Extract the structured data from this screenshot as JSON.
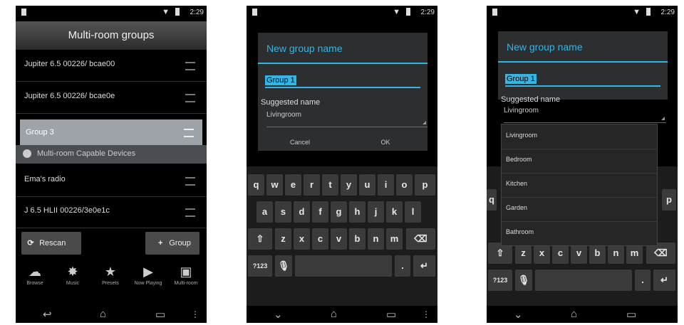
{
  "status": {
    "time": "2:29"
  },
  "screen1": {
    "title": "Multi-room groups",
    "groups": [
      "Jupiter 6.5 00226/ bcae00",
      "Jupiter 6.5 00226/ bcae0e"
    ],
    "dragged_item": "Group 3",
    "capable_header": "Multi-room Capable Devices",
    "devices": [
      "Ema's radio",
      "J 6.5 HLII 00226/3e0e1c"
    ],
    "rescan_label": "Rescan",
    "group_label": "Group",
    "tabs": [
      {
        "label": "Browse",
        "icon": "browse-icon"
      },
      {
        "label": "Music",
        "icon": "music-icon"
      },
      {
        "label": "Presets",
        "icon": "presets-icon"
      },
      {
        "label": "Now Playing",
        "icon": "now-playing-icon"
      },
      {
        "label": "Multi-room",
        "icon": "multi-room-icon"
      }
    ]
  },
  "dialog": {
    "title": "New group name",
    "input_value": "Group 1",
    "suggested_label": "Suggested name",
    "suggested_value": "Livingroom",
    "cancel_label": "Cancel",
    "ok_label": "OK"
  },
  "keyboard": {
    "row1": [
      "q",
      "w",
      "e",
      "r",
      "t",
      "y",
      "u",
      "i",
      "o",
      "p"
    ],
    "row2": [
      "a",
      "s",
      "d",
      "f",
      "g",
      "h",
      "j",
      "k",
      "l"
    ],
    "row3": [
      "z",
      "x",
      "c",
      "v",
      "b",
      "n",
      "m"
    ],
    "symbols_label": "?123"
  },
  "screen3": {
    "spinner_value": "Livingroom",
    "options": [
      "Livingroom",
      "Bedroom",
      "Kitchen",
      "Garden",
      "Bathroom"
    ],
    "row2_partial_left": "q",
    "row2_partial_right": "p"
  }
}
